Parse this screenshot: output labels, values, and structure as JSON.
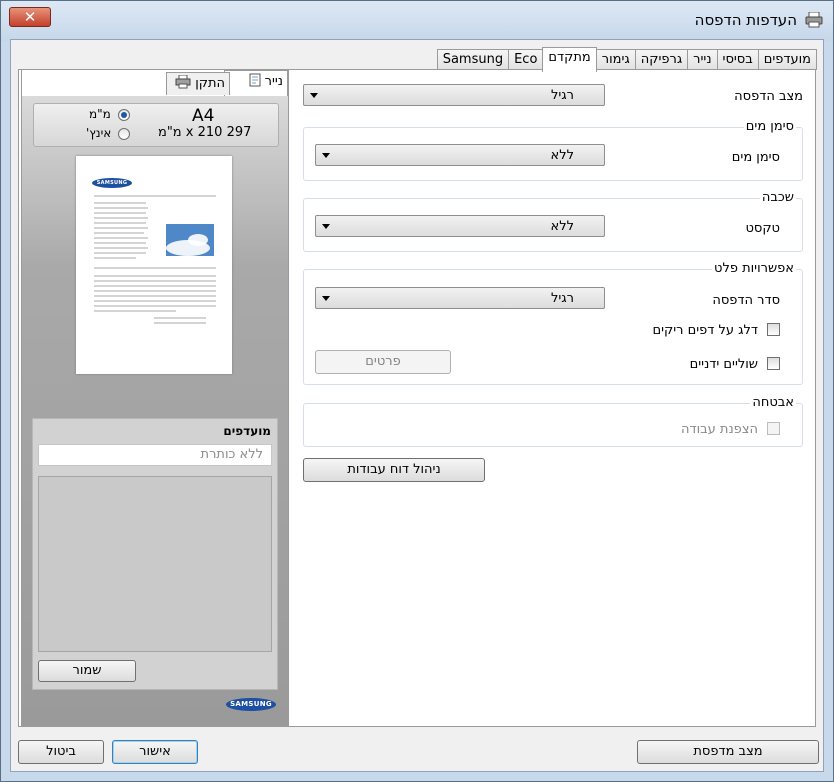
{
  "window": {
    "title": "העדפות הדפסה",
    "close_label": "✕"
  },
  "tabs": [
    {
      "label": "מועדפים",
      "active": false
    },
    {
      "label": "בסיסי",
      "active": false
    },
    {
      "label": "נייר",
      "active": false
    },
    {
      "label": "גרפיקה",
      "active": false
    },
    {
      "label": "גימור",
      "active": false
    },
    {
      "label": "מתקדם",
      "active": true
    },
    {
      "label": "Eco",
      "active": false
    },
    {
      "label": "Samsung",
      "active": false
    }
  ],
  "preview": {
    "tab_paper": "נייר",
    "tab_device": "התקן",
    "paper_name": "A4",
    "paper_dims": "297 x 210 מ\"מ",
    "unit_mm": "מ\"מ",
    "unit_inch": "אינץ'",
    "unit_selected": "mm",
    "logo_text": "SAMSUNG",
    "favorites": {
      "title": "מועדפים",
      "placeholder": "ללא כותרת",
      "save_label": "שמור"
    }
  },
  "advanced": {
    "print_mode": {
      "label": "מצב הדפסה",
      "value": "רגיל"
    },
    "watermark": {
      "title": "סימן מים",
      "label": "סימן מים",
      "value": "ללא"
    },
    "overlay": {
      "title": "שכבה",
      "label": "טקסט",
      "value": "ללא"
    },
    "output": {
      "title": "אפשרויות פלט",
      "order_label": "סדר הדפסה",
      "order_value": "רגיל",
      "skip_blank_label": "דלג על דפים ריקים",
      "manual_margins_label": "שוליים ידניים",
      "details_label": "פרטים"
    },
    "security": {
      "title": "אבטחה",
      "encrypt_label": "הצפנת עבודה"
    },
    "job_report_label": "ניהול דוח עבודות"
  },
  "footer": {
    "printer_status_label": "מצב מדפסת",
    "ok_label": "אישור",
    "cancel_label": "ביטול"
  }
}
